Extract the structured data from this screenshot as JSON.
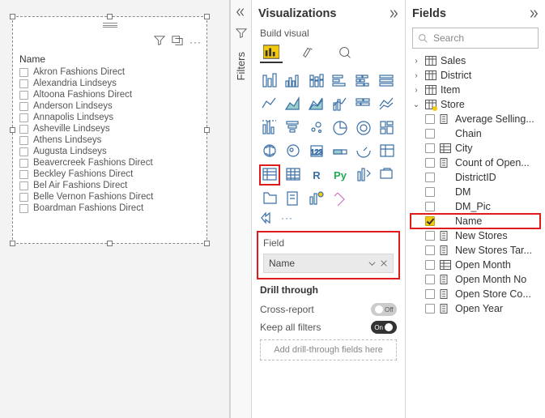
{
  "canvas": {
    "slicer_title": "Name",
    "slicer_items": [
      "Akron Fashions Direct",
      "Alexandria Lindseys",
      "Altoona Fashions Direct",
      "Anderson Lindseys",
      "Annapolis Lindseys",
      "Asheville Lindseys",
      "Athens Lindseys",
      "Augusta Lindseys",
      "Beavercreek Fashions Direct",
      "Beckley Fashions Direct",
      "Bel Air Fashions Direct",
      "Belle Vernon Fashions Direct",
      "Boardman Fashions Direct"
    ],
    "more_glyph": "···"
  },
  "filters_label": "Filters",
  "viz": {
    "title": "Visualizations",
    "build_label": "Build visual",
    "field_section": "Field",
    "field_value": "Name",
    "drill_section": "Drill through",
    "cross_report": "Cross-report",
    "keep_filters": "Keep all filters",
    "off_label": "Off",
    "on_label": "On",
    "add_dt": "Add drill-through fields here",
    "more": "···",
    "r_label": "R",
    "py_label": "Py"
  },
  "fields": {
    "title": "Fields",
    "search_placeholder": "Search",
    "tables": [
      {
        "name": "Sales",
        "expanded": false
      },
      {
        "name": "District",
        "expanded": false
      },
      {
        "name": "Item",
        "expanded": false
      },
      {
        "name": "Store",
        "expanded": true,
        "marked": true,
        "children": [
          {
            "name": "Average Selling...",
            "icon": "calc"
          },
          {
            "name": "Chain",
            "icon": "none"
          },
          {
            "name": "City",
            "icon": "hier"
          },
          {
            "name": "Count of Open...",
            "icon": "calc"
          },
          {
            "name": "DistrictID",
            "icon": "none"
          },
          {
            "name": "DM",
            "icon": "none"
          },
          {
            "name": "DM_Pic",
            "icon": "none"
          },
          {
            "name": "Name",
            "icon": "none",
            "checked": true,
            "highlight": true
          },
          {
            "name": "New Stores",
            "icon": "calc"
          },
          {
            "name": "New Stores Tar...",
            "icon": "calc"
          },
          {
            "name": "Open Month",
            "icon": "hier"
          },
          {
            "name": "Open Month No",
            "icon": "calc"
          },
          {
            "name": "Open Store Co...",
            "icon": "calc"
          },
          {
            "name": "Open Year",
            "icon": "calc"
          }
        ]
      }
    ]
  }
}
